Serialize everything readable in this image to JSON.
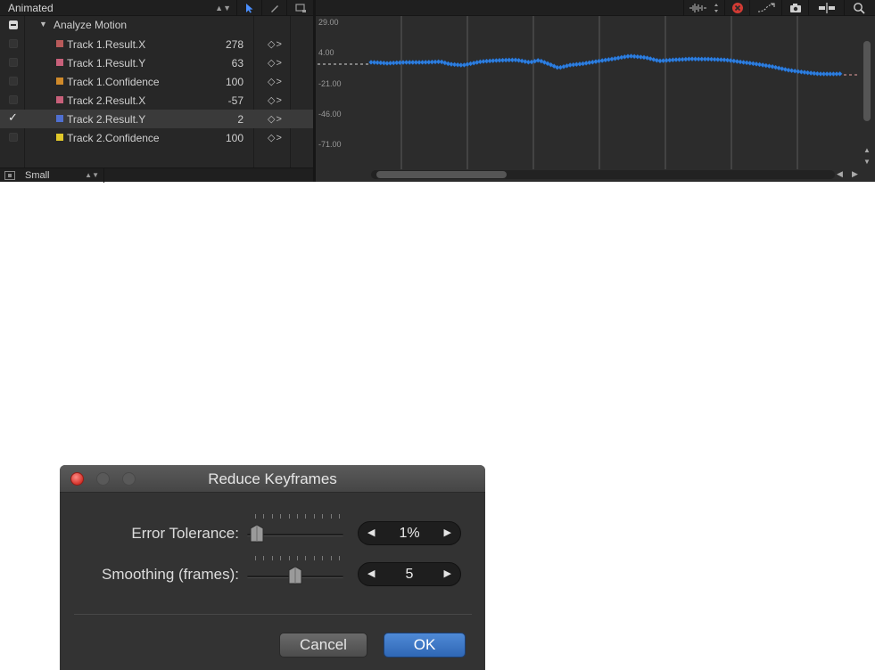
{
  "editor": {
    "filter_label": "Animated",
    "group_name": "Analyze Motion",
    "parameters": [
      {
        "name": "Track 1.Result.X",
        "value": "278",
        "color": "#b85a5a",
        "checked": false
      },
      {
        "name": "Track 1.Result.Y",
        "value": "63",
        "color": "#c8607a",
        "checked": false
      },
      {
        "name": "Track 1.Confidence",
        "value": "100",
        "color": "#d08a2a",
        "checked": false
      },
      {
        "name": "Track 2.Result.X",
        "value": "-57",
        "color": "#c8607a",
        "checked": false
      },
      {
        "name": "Track 2.Result.Y",
        "value": "2",
        "color": "#4f6fd0",
        "checked": true,
        "check_mark": "✓"
      },
      {
        "name": "Track 2.Confidence",
        "value": "100",
        "color": "#e0c82a",
        "checked": false
      }
    ],
    "size_label": "Small",
    "graph": {
      "y_labels": [
        "29.00",
        "4.00",
        "-21.00",
        "-46.00",
        "-71.00"
      ],
      "curve_color": "#2e7fe0",
      "selected_tool_color": "#4a8fff",
      "delete_icon_color": "#d23b34"
    }
  },
  "dialog": {
    "title": "Reduce Keyframes",
    "error_tolerance": {
      "label": "Error Tolerance:",
      "value": "1%",
      "slider_position": 0.1
    },
    "smoothing": {
      "label": "Smoothing (frames):",
      "value": "5",
      "slider_position": 0.5
    },
    "cancel_label": "Cancel",
    "ok_label": "OK",
    "ok_color": "#3572c4"
  }
}
